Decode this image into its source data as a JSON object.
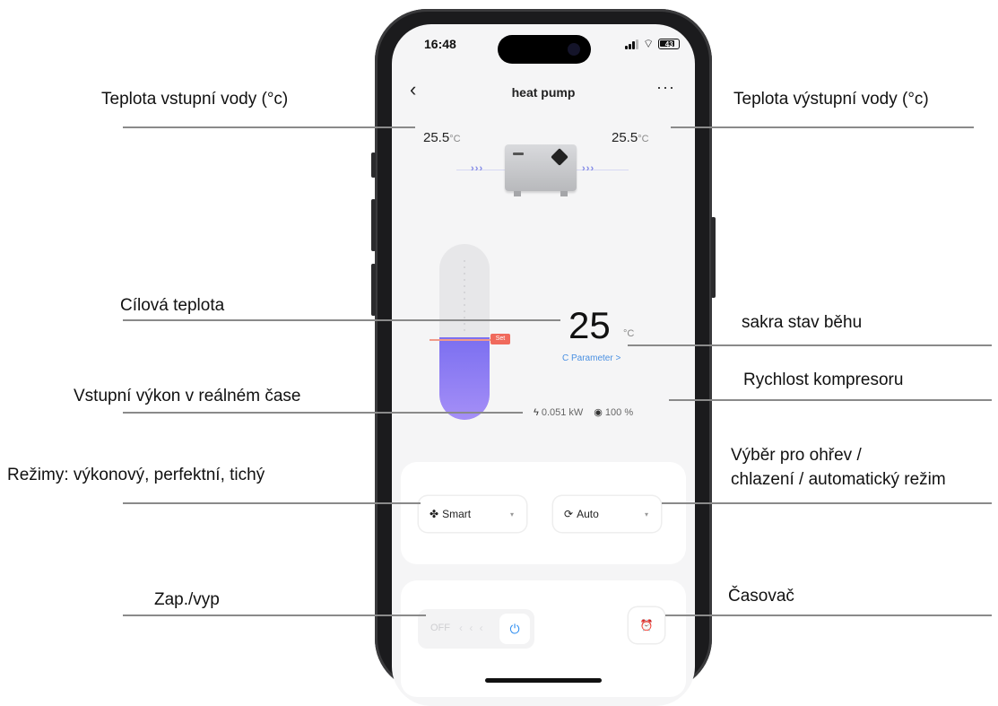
{
  "annotations": {
    "inlet_temp": "Teplota vstupní vody (°c)",
    "outlet_temp": "Teplota výstupní vody (°c)",
    "target_temp": "Cílová teplota",
    "run_state": "sakra stav běhu",
    "compressor_speed": "Rychlost kompresoru",
    "input_power": "Vstupní výkon v reálném čase",
    "modes": "Režimy: výkonový, perfektní, tichý",
    "heat_cool_line1": "Výběr pro ohřev /",
    "heat_cool_line2": "chlazení / automatický režim",
    "power": "Zap./vyp",
    "timer": "Časovač"
  },
  "status_bar": {
    "time": "16:48",
    "battery": "43"
  },
  "nav": {
    "back": "‹",
    "title": "heat pump",
    "more": "···"
  },
  "water": {
    "inlet_value": "25.5",
    "inlet_unit": "°C",
    "outlet_value": "25.5",
    "outlet_unit": "°C",
    "flow_arrows": "› › ›"
  },
  "thermostat": {
    "set_tag": "Set",
    "level": 0.47
  },
  "target": {
    "value": "25",
    "unit": "°C",
    "parameter_link": "C Parameter >"
  },
  "stats": {
    "power": "0.051 kW",
    "compressor": "100 %"
  },
  "mode_select": {
    "label": "Smart",
    "chevron": "▾"
  },
  "heat_cool_select": {
    "label": "Auto",
    "chevron": "▾"
  },
  "power_toggle": {
    "off_label": "OFF",
    "arrows": "‹ ‹ ‹",
    "power_icon": "⏻"
  },
  "timer": {
    "icon": "⏰"
  },
  "colors": {
    "accent_purple": "#8a7cf3",
    "set_red": "#f06a5c",
    "link_blue": "#4a90e2",
    "power_blue": "#2b8cf0"
  }
}
